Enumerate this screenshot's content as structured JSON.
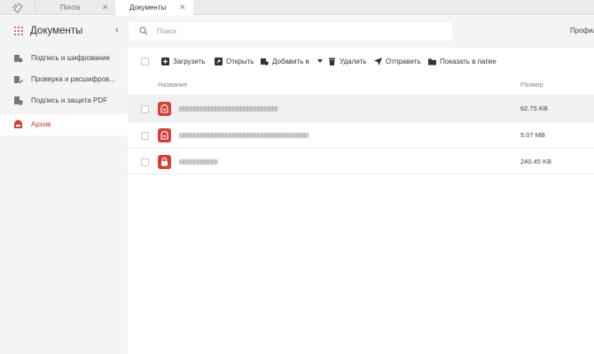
{
  "tabs": [
    {
      "label": "Почта",
      "close": "✕"
    },
    {
      "label": "Документы",
      "close": "✕"
    }
  ],
  "sidebar": {
    "title": "Документы",
    "collapse": "‹",
    "items": [
      {
        "label": "Подпись и шифрование"
      },
      {
        "label": "Проверка и расшифров..."
      },
      {
        "label": "Подпись и защита PDF"
      },
      {
        "label": "Архив"
      }
    ]
  },
  "search": {
    "placeholder": "Поиск",
    "value": ""
  },
  "header": {
    "profile": "Профил"
  },
  "toolbar": {
    "upload": "Загрузить",
    "open": "Открыть",
    "add_to": "Добавить в",
    "delete": "Удалить",
    "send": "Отправить",
    "show_in_folder": "Показать в папке"
  },
  "table": {
    "columns": {
      "name": "Название",
      "size": "Размер"
    },
    "rows": [
      {
        "size": "62.75 KB"
      },
      {
        "size": "5.07 MB"
      },
      {
        "size": "240.45 KB"
      }
    ]
  },
  "colors": {
    "accent": "#d24038",
    "sidebar_bg": "#f4f4f5"
  }
}
